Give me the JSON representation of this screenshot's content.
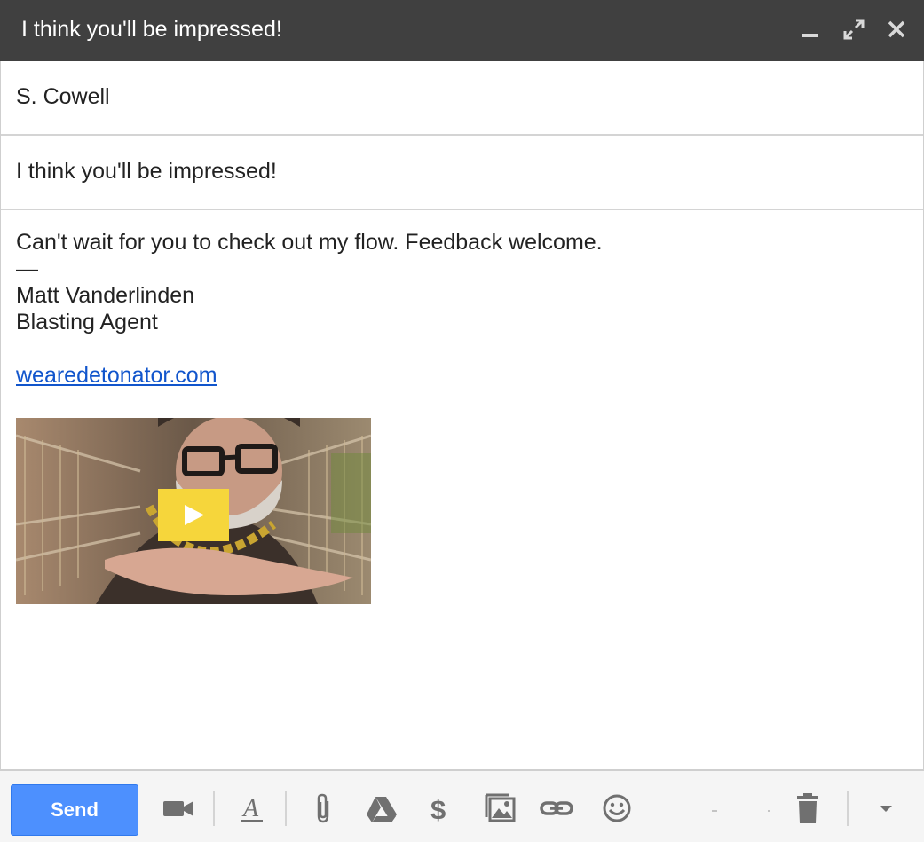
{
  "window": {
    "title": "I think you'll be impressed!",
    "controls": [
      "minimize-icon",
      "expand-icon",
      "close-icon"
    ]
  },
  "compose": {
    "to": "S. Cowell",
    "subject": "I think you'll be impressed!",
    "body_lines": [
      "Can't wait for you to check out my flow. Feedback welcome.",
      "—",
      "Matt Vanderlinden",
      "Blasting Agent"
    ],
    "link": "wearedetonator.com"
  },
  "video": {
    "play_icon": "play-icon",
    "accent_color": "#f6d63b"
  },
  "toolbar": {
    "send_label": "Send",
    "icons": [
      "video-camera-icon",
      "text-format-icon",
      "paperclip-icon",
      "drive-icon",
      "dollar-icon",
      "photo-icon",
      "link-icon",
      "emoji-icon",
      "trash-icon",
      "chevron-down-icon"
    ],
    "send_color": "#4d90fe"
  }
}
